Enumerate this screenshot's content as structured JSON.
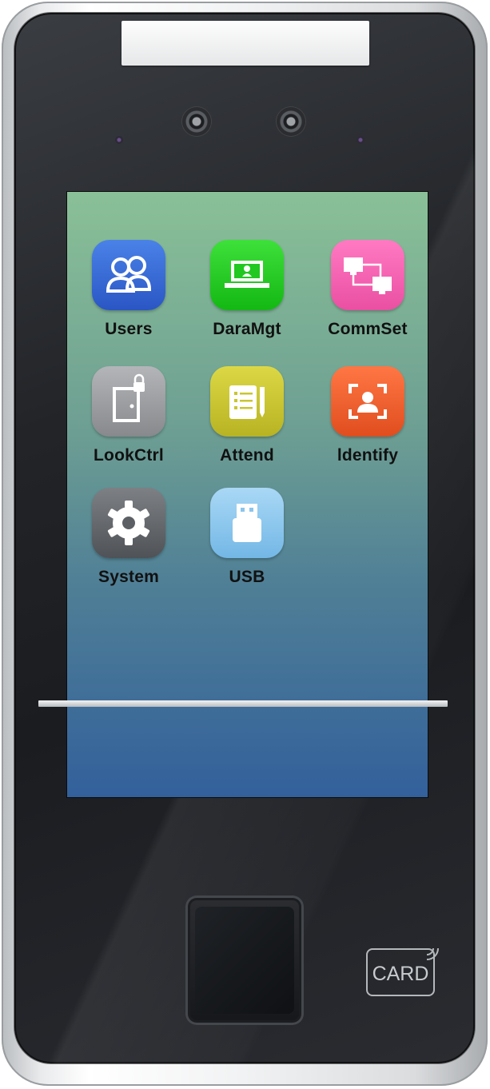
{
  "device": {
    "card_label": "CARD"
  },
  "apps": [
    {
      "label": "Users",
      "icon": "users-icon",
      "color": "#3367d6"
    },
    {
      "label": "DaraMgt",
      "icon": "data-management-icon",
      "color": "#20c81f"
    },
    {
      "label": "CommSet",
      "icon": "network-icon",
      "color": "#f25fb1"
    },
    {
      "label": "LookCtrl",
      "icon": "door-lock-icon",
      "color": "#8f9295"
    },
    {
      "label": "Attend",
      "icon": "attendance-icon",
      "color": "#c9c62f"
    },
    {
      "label": "ldentify",
      "icon": "face-identify-icon",
      "color": "#f0602e"
    },
    {
      "label": "System",
      "icon": "gear-icon",
      "color": "#6b6e72"
    },
    {
      "label": "USB",
      "icon": "usb-icon",
      "color": "#87c4ec"
    }
  ]
}
